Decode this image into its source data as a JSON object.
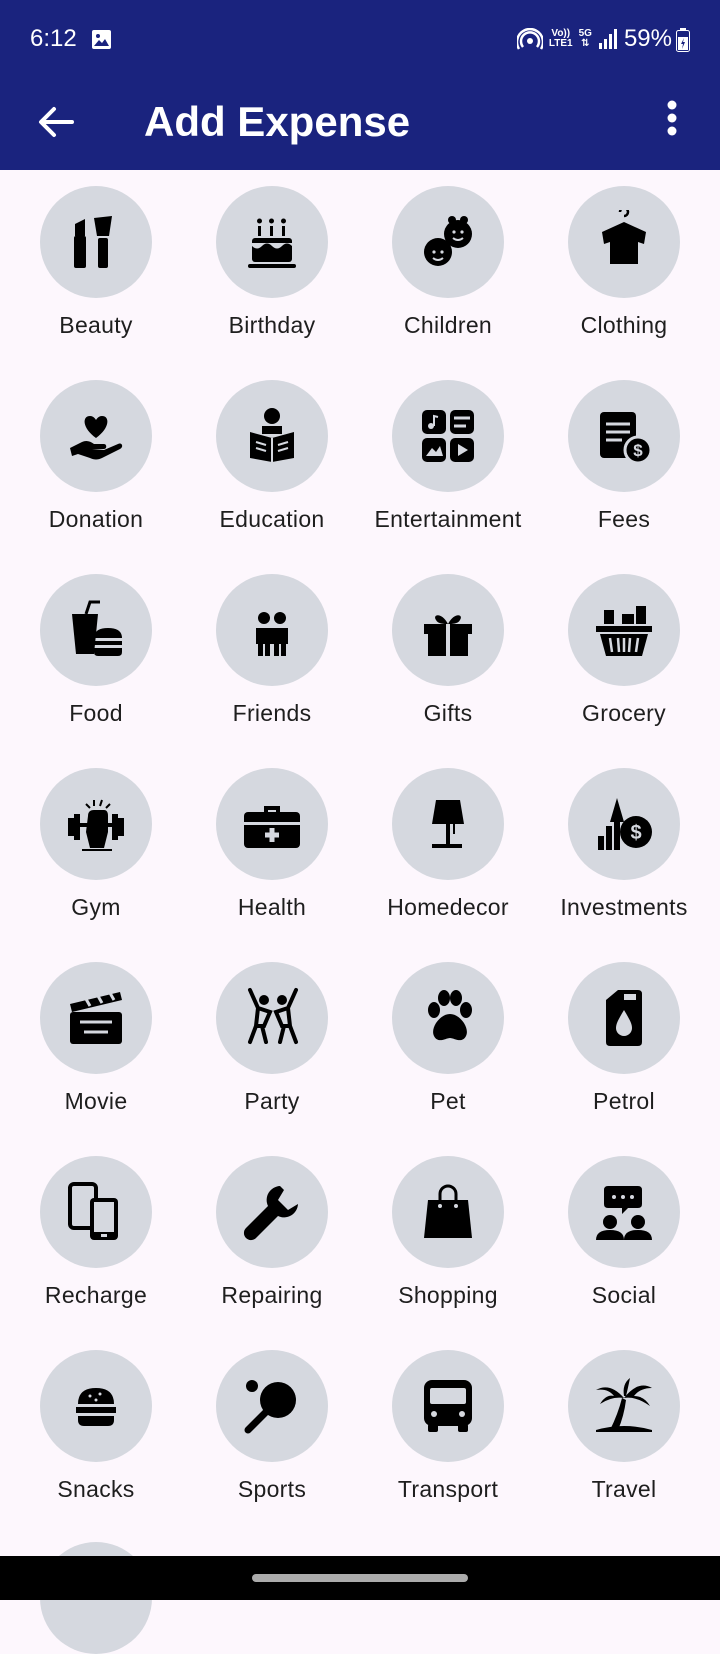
{
  "status_bar": {
    "time": "6:12",
    "battery": "59%",
    "network_top": "Vo))",
    "network_bottom": "LTE1",
    "network_5g": "5G"
  },
  "header": {
    "title": "Add Expense",
    "background_color": "#1A237E"
  },
  "categories": [
    {
      "label": "Beauty",
      "icon": "beauty-icon"
    },
    {
      "label": "Birthday",
      "icon": "birthday-cake-icon"
    },
    {
      "label": "Children",
      "icon": "children-icon"
    },
    {
      "label": "Clothing",
      "icon": "clothing-icon"
    },
    {
      "label": "Donation",
      "icon": "donation-icon"
    },
    {
      "label": "Education",
      "icon": "education-icon"
    },
    {
      "label": "Entertainment",
      "icon": "entertainment-icon"
    },
    {
      "label": "Fees",
      "icon": "fees-icon"
    },
    {
      "label": "Food",
      "icon": "food-icon"
    },
    {
      "label": "Friends",
      "icon": "friends-icon"
    },
    {
      "label": "Gifts",
      "icon": "gift-icon"
    },
    {
      "label": "Grocery",
      "icon": "grocery-basket-icon"
    },
    {
      "label": "Gym",
      "icon": "gym-icon"
    },
    {
      "label": "Health",
      "icon": "medical-kit-icon"
    },
    {
      "label": "Homedecor",
      "icon": "lamp-icon"
    },
    {
      "label": "Investments",
      "icon": "investments-icon"
    },
    {
      "label": "Movie",
      "icon": "clapperboard-icon"
    },
    {
      "label": "Party",
      "icon": "party-dance-icon"
    },
    {
      "label": "Pet",
      "icon": "paw-icon"
    },
    {
      "label": "Petrol",
      "icon": "jerrycan-icon"
    },
    {
      "label": "Recharge",
      "icon": "phones-icon"
    },
    {
      "label": "Repairing",
      "icon": "wrench-icon"
    },
    {
      "label": "Shopping",
      "icon": "shopping-bag-icon"
    },
    {
      "label": "Social",
      "icon": "social-chat-icon"
    },
    {
      "label": "Snacks",
      "icon": "burger-icon"
    },
    {
      "label": "Sports",
      "icon": "ping-pong-icon"
    },
    {
      "label": "Transport",
      "icon": "bus-icon"
    },
    {
      "label": "Travel",
      "icon": "palm-tree-icon"
    }
  ],
  "colors": {
    "app_bar": "#1A237E",
    "page_background": "#FDF7FD",
    "icon_circle": "#D5D8DF",
    "icon": "#000000"
  }
}
